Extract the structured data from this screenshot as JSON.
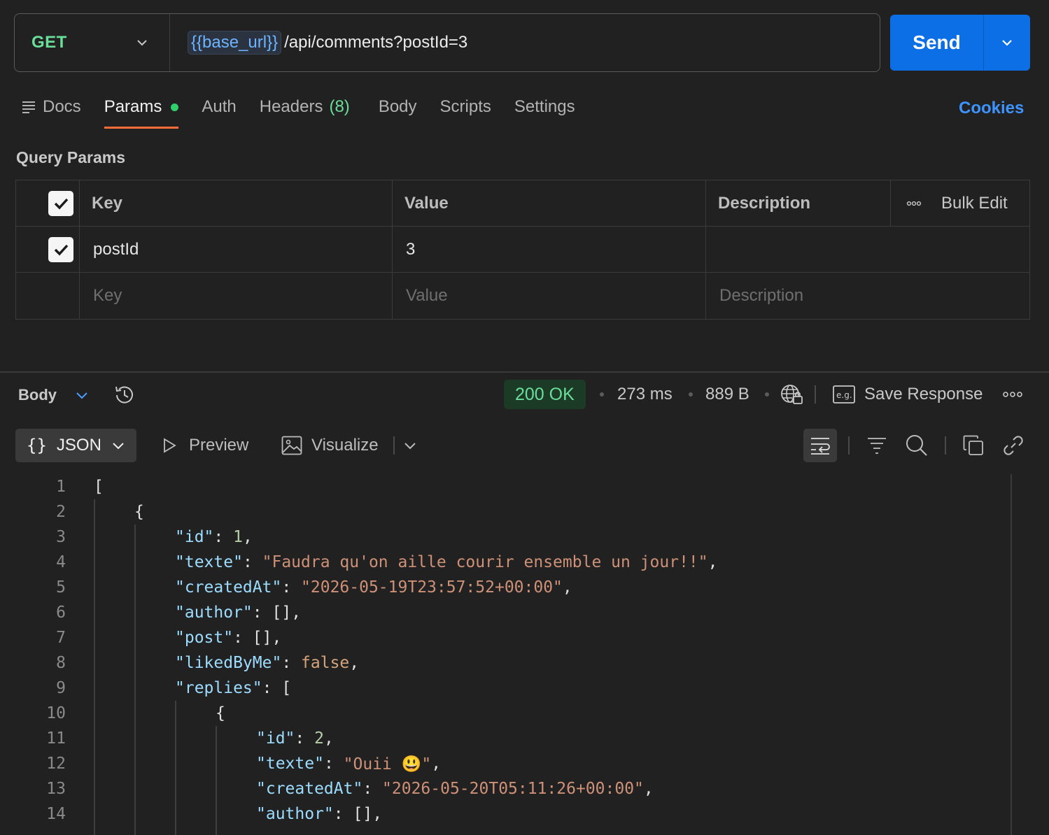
{
  "request": {
    "method": "GET",
    "url_variable": "{{base_url}}",
    "url_path": "/api/comments?postId=3",
    "send_label": "Send"
  },
  "tabs": {
    "docs": "Docs",
    "params": "Params",
    "auth": "Auth",
    "headers": "Headers",
    "headers_count": "(8)",
    "body": "Body",
    "scripts": "Scripts",
    "settings": "Settings",
    "cookies": "Cookies"
  },
  "query_params": {
    "title": "Query Params",
    "headers": {
      "key": "Key",
      "value": "Value",
      "description": "Description",
      "bulk_edit": "Bulk Edit"
    },
    "rows": [
      {
        "key": "postId",
        "value": "3",
        "description": ""
      }
    ],
    "placeholders": {
      "key": "Key",
      "value": "Value",
      "description": "Description"
    }
  },
  "response": {
    "section_label": "Body",
    "status": "200 OK",
    "time": "273 ms",
    "size": "889 B",
    "save_label": "Save Response",
    "format_label": "JSON",
    "preview_label": "Preview",
    "visualize_label": "Visualize"
  },
  "code": {
    "line_numbers": [
      "1",
      "2",
      "3",
      "4",
      "5",
      "6",
      "7",
      "8",
      "9",
      "10",
      "11",
      "12",
      "13",
      "14"
    ],
    "l1": "[",
    "l2": "{",
    "l3_key": "\"id\"",
    "l3_val": "1",
    "l4_key": "\"texte\"",
    "l4_val": "\"Faudra qu'on aille courir ensemble un jour!!\"",
    "l5_key": "\"createdAt\"",
    "l5_val": "\"2026-05-19T23:57:52+00:00\"",
    "l6_key": "\"author\"",
    "l6_val": "[]",
    "l7_key": "\"post\"",
    "l7_val": "[]",
    "l8_key": "\"likedByMe\"",
    "l8_val": "false",
    "l9_key": "\"replies\"",
    "l9_val": "[",
    "l10": "{",
    "l11_key": "\"id\"",
    "l11_val": "2",
    "l12_key": "\"texte\"",
    "l12_val": "\"Ouii 😃\"",
    "l13_key": "\"createdAt\"",
    "l13_val": "\"2026-05-20T05:11:26+00:00\"",
    "l14_key": "\"author\"",
    "l14_val": "[]"
  },
  "colors": {
    "accent": "#0d6fe6",
    "method": "#6bdd9a",
    "tab_underline": "#ff6c37",
    "cookies": "#3d94ff"
  },
  "icons": [
    "chevron-down-icon",
    "docs-icon",
    "checkbox-checked-icon",
    "more-icon",
    "history-icon",
    "globe-lock-icon",
    "example-icon",
    "play-icon",
    "image-icon",
    "wrap-icon",
    "filter-icon",
    "search-icon",
    "copy-icon",
    "link-icon"
  ]
}
